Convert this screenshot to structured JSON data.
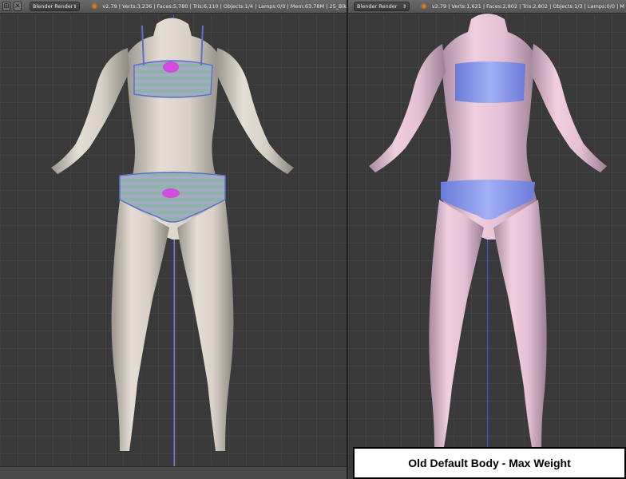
{
  "colors": {
    "header_bg": "#5c5c5c",
    "viewport_bg": "#393939",
    "axis_blue": "#3a55ff",
    "axis_red": "#e0b0a0",
    "left_skin": "#d8d2c8",
    "right_skin": "#e8bfd4",
    "stripe_blue": "#9aa6c0",
    "stripe_teal": "#8fb5a6",
    "bow_pink": "#d24ddb",
    "right_garment": "#7f8ef0"
  },
  "left_panel": {
    "header": {
      "icon_add": "⊞",
      "icon_close": "✕",
      "render_engine": "Blender Render",
      "logo_icon": "blender-logo-icon",
      "stats": "v2.79 | Verts:3,236 | Faces:5,780 | Tris:6,110 | Objects:1/4 | Lamps:0/0 | Mem:63.78M | 25_Bik"
    }
  },
  "right_panel": {
    "header": {
      "render_engine": "Blender Render",
      "logo_icon": "blender-logo-icon",
      "stats": "v2.79 | Verts:1,621 | Faces:2,802 | Tris:2,802 | Objects:1/3 | Lamps:0/0 | M"
    }
  },
  "caption": "Old Default Body - Max Weight"
}
